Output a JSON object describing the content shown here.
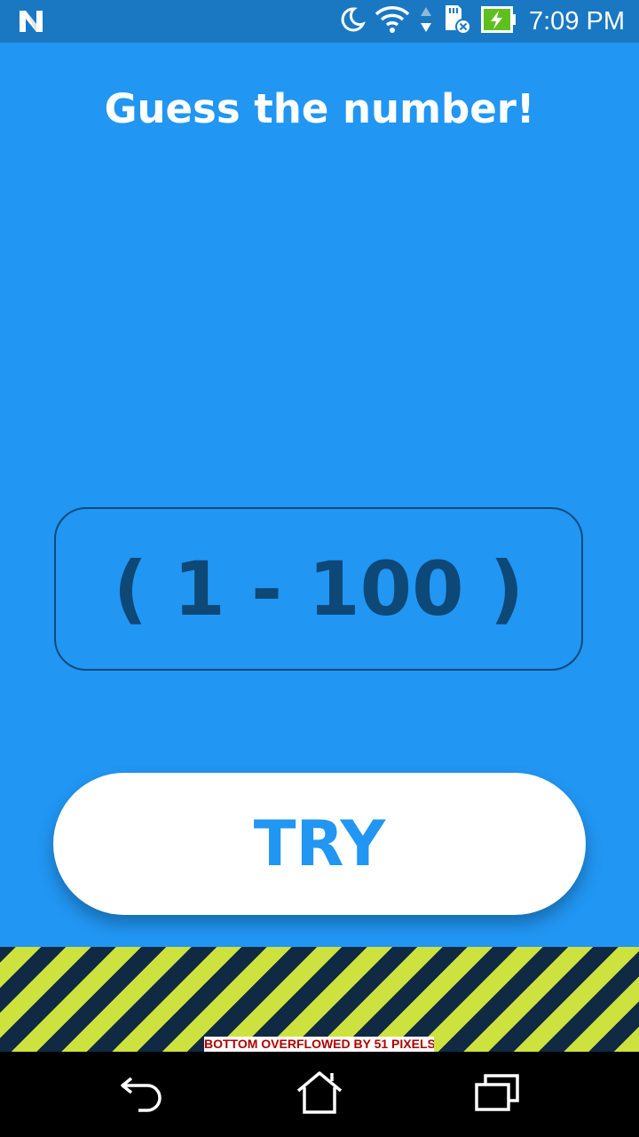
{
  "status_bar": {
    "time": "7:09 PM",
    "icons": [
      "n-logo-icon",
      "moon-icon",
      "wifi-icon",
      "data-arrows-icon",
      "sd-card-icon",
      "battery-charging-icon"
    ]
  },
  "screen": {
    "title": "Guess the number!",
    "input_placeholder": "( 1 - 100 )",
    "try_button_label": "TRY"
  },
  "overflow_warning": "BOTTOM OVERFLOWED BY 51 PIXELS",
  "nav_bar": {
    "icons": [
      "back-icon",
      "home-icon",
      "recents-icon"
    ]
  },
  "colors": {
    "background": "#2196f3",
    "status_bar": "#1a78c2",
    "input_border": "#0e4a7a",
    "input_text": "#0e4877",
    "button_bg": "#ffffff",
    "button_text": "#2196f3",
    "stripe_yellow": "#cde23f",
    "stripe_navy": "#102a43",
    "overflow_text": "#b00000"
  }
}
